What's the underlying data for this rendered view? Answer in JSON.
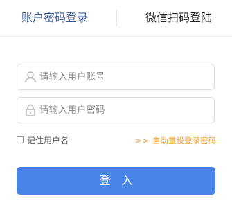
{
  "tabs": {
    "account_password_login": "账户密码登录",
    "wechat_scan_login": "微信扫码登陆"
  },
  "form": {
    "username_placeholder": "请输入用户账号",
    "password_placeholder": "请输入用户密码",
    "username_icon": "user-icon",
    "password_icon": "lock-icon"
  },
  "options": {
    "remember_label": "记住用户名",
    "reset_arrows": ">>",
    "reset_label": "自助重设登录密码"
  },
  "actions": {
    "login_label": "登入"
  },
  "colors": {
    "active_tab": "#3c6096",
    "accent_button": "#4a86e8",
    "reset_link": "#f0a030",
    "field_border": "#dcdcdc"
  }
}
